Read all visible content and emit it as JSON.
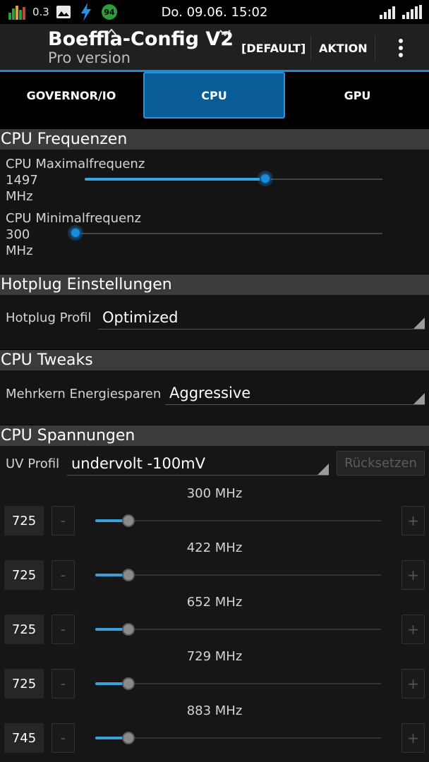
{
  "status_bar": {
    "net_speed": "0.3",
    "battery": "94",
    "datetime": "Do. 09.06. 15:02"
  },
  "action_bar": {
    "title": "Boeffla-Config V2",
    "subtitle": "Pro version",
    "default_label": "[DEFAULT]",
    "action_label": "AKTION",
    "overflow_icon": "more-vert-icon",
    "accent": "#1c8bd6"
  },
  "tabs": [
    {
      "label": "GOVERNOR/IO",
      "selected": false
    },
    {
      "label": "CPU",
      "selected": true
    },
    {
      "label": "GPU",
      "selected": false
    }
  ],
  "cpu_freq": {
    "header": "CPU Frequenzen",
    "max": {
      "label": "CPU Maximalfrequenz",
      "value": "1497",
      "unit": "MHz",
      "level": 0.6
    },
    "min": {
      "label": "CPU Minimalfrequenz",
      "value": "300",
      "unit": "MHz",
      "level": 0.0
    }
  },
  "hotplug": {
    "header": "Hotplug Einstellungen",
    "label": "Hotplug Profil",
    "value": "Optimized"
  },
  "tweaks": {
    "header": "CPU Tweaks",
    "label": "Mehrkern Energiesparen",
    "value": "Aggressive"
  },
  "voltages": {
    "header": "CPU Spannungen",
    "profile_label": "UV Profil",
    "profile_value": "undervolt -100mV",
    "reset_label": "Rücksetzen",
    "minus": "-",
    "plus": "+",
    "rows": [
      {
        "freq": "300 MHz",
        "value": "725"
      },
      {
        "freq": "422 MHz",
        "value": "725"
      },
      {
        "freq": "652 MHz",
        "value": "725"
      },
      {
        "freq": "729 MHz",
        "value": "725"
      },
      {
        "freq": "883 MHz",
        "value": "745"
      }
    ]
  }
}
